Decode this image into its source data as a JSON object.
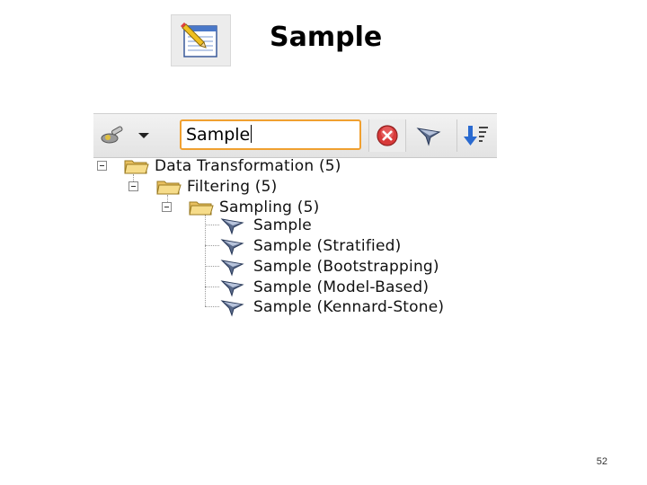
{
  "slide": {
    "title": "Sample",
    "page_number": "52"
  },
  "search": {
    "value": "Sample"
  },
  "icons": {
    "slide": "notepad-pencil-icon",
    "settings": "wrench-gear-icon",
    "dropdown": "chevron-down-icon",
    "clear": "clear-search-icon",
    "operator": "funnel-operator-icon",
    "sort": "sort-down-icon"
  },
  "tree": {
    "root": {
      "label": "Data Transformation (5)"
    },
    "filtering": {
      "label": "Filtering (5)"
    },
    "sampling": {
      "label": "Sampling (5)"
    },
    "operators": [
      {
        "label": "Sample"
      },
      {
        "label": "Sample (Stratified)"
      },
      {
        "label": "Sample (Bootstrapping)"
      },
      {
        "label": "Sample (Model-Based)"
      },
      {
        "label": "Sample (Kennard-Stone)"
      }
    ]
  }
}
